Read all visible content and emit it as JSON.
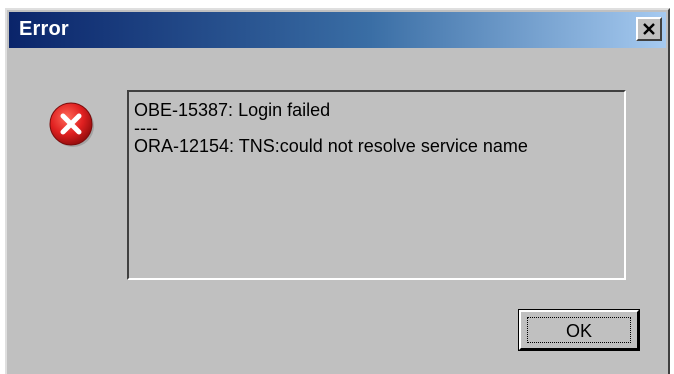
{
  "window": {
    "title": "Error",
    "close_icon": "close-icon"
  },
  "icon": {
    "name": "error-icon",
    "color": "#e02020"
  },
  "message": {
    "lines": [
      "OBE-15387: Login failed",
      "----",
      "ORA-12154: TNS:could not resolve service name"
    ]
  },
  "buttons": {
    "ok_label": "OK"
  },
  "colors": {
    "titlebar_start": "#0a246a",
    "titlebar_end": "#a6caf0",
    "face": "#c0c0c0"
  }
}
